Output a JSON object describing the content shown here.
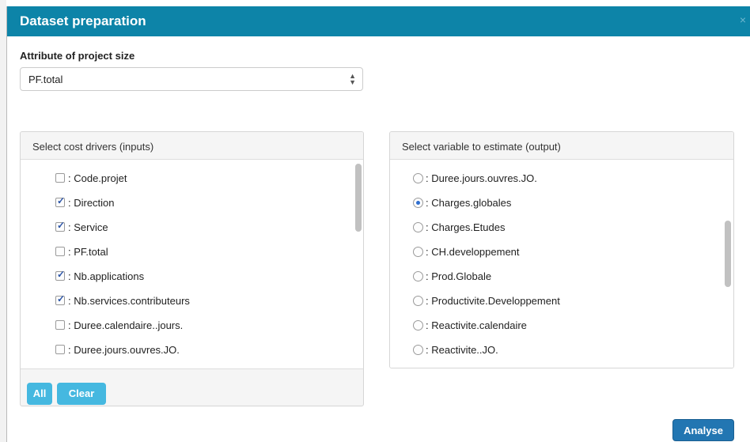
{
  "dialog": {
    "title": "Dataset preparation",
    "close_symbol": "×"
  },
  "project_size": {
    "label": "Attribute of project size",
    "selected": "PF.total"
  },
  "inputs_panel": {
    "heading": "Select cost drivers (inputs)",
    "items": [
      {
        "label": ": Code.projet",
        "checked": false
      },
      {
        "label": ": Direction",
        "checked": true
      },
      {
        "label": ": Service",
        "checked": true
      },
      {
        "label": ": PF.total",
        "checked": false
      },
      {
        "label": ": Nb.applications",
        "checked": true
      },
      {
        "label": ": Nb.services.contributeurs",
        "checked": true
      },
      {
        "label": ": Duree.calendaire..jours.",
        "checked": false
      },
      {
        "label": ": Duree.jours.ouvres.JO.",
        "checked": false
      }
    ],
    "buttons": {
      "all": "All",
      "clear": "Clear"
    }
  },
  "output_panel": {
    "heading": "Select variable to estimate (output)",
    "items": [
      {
        "label": ": Duree.jours.ouvres.JO.",
        "selected": false
      },
      {
        "label": ": Charges.globales",
        "selected": true
      },
      {
        "label": ": Charges.Etudes",
        "selected": false
      },
      {
        "label": ": CH.developpement",
        "selected": false
      },
      {
        "label": ": Prod.Globale",
        "selected": false
      },
      {
        "label": ": Productivite.Developpement",
        "selected": false
      },
      {
        "label": ": Reactivite.calendaire",
        "selected": false
      },
      {
        "label": ": Reactivite..JO.",
        "selected": false
      }
    ]
  },
  "footer": {
    "analyse_label": "Analyse"
  },
  "colors": {
    "header": "#0d84a8",
    "button": "#45b8e0",
    "primary_button": "#2276b2"
  }
}
